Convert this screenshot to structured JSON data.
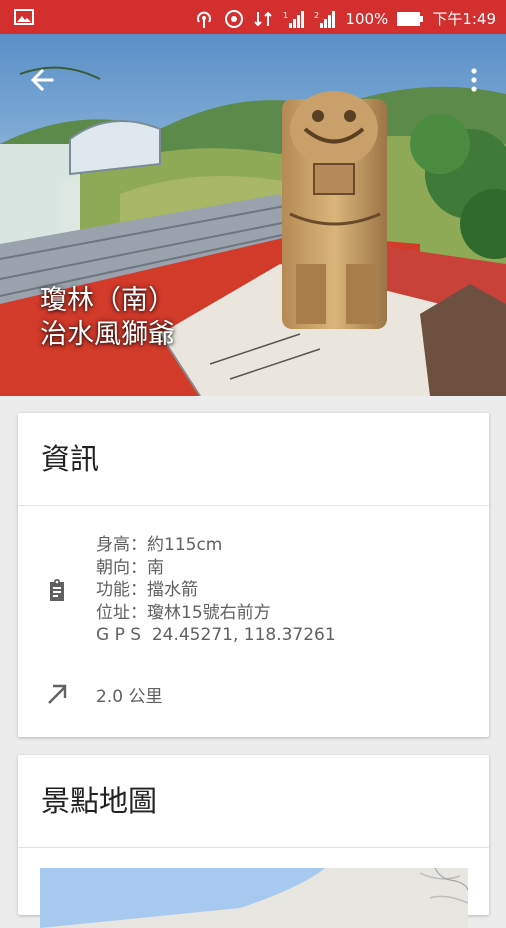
{
  "status_bar": {
    "battery": "100%",
    "time": "下午1:49"
  },
  "hero": {
    "title_line1": "瓊林（南）",
    "title_line2": "治水風獅爺"
  },
  "info_card": {
    "title": "資訊",
    "height": "身高：約115cm",
    "direction": "朝向：南",
    "function": "功能：擋水箭",
    "location": "位址：瓊林15號右前方",
    "gps": "G P S  24.45271, 118.37261",
    "distance": "2.0 公里"
  },
  "map_card": {
    "title": "景點地圖"
  },
  "colors": {
    "status_bar": "#d32f2f",
    "background": "#ececec",
    "card": "#ffffff"
  }
}
